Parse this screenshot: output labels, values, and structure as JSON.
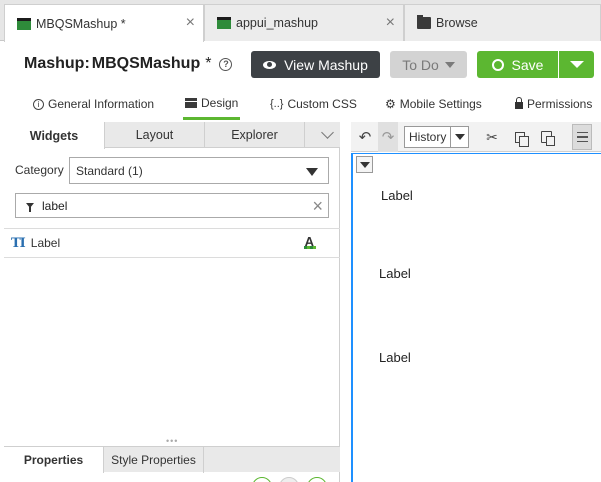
{
  "tabs": [
    {
      "label": "MBQSMashup *",
      "icon": "mashup-icon"
    },
    {
      "label": "appui_mashup",
      "icon": "mashup-icon"
    },
    {
      "label": "Browse",
      "icon": "folder-icon"
    }
  ],
  "close_glyph": "×",
  "header": {
    "title_prefix": "Mashup:",
    "title_name": "MBQSMashup",
    "modified_marker": "*",
    "view_button": "View Mashup",
    "todo_button": "To Do",
    "save_button": "Save"
  },
  "subnav": [
    "General Information",
    "Design",
    "Custom CSS",
    "Mobile Settings",
    "Permissions"
  ],
  "panel": {
    "tabs": [
      "Widgets",
      "Layout",
      "Explorer"
    ],
    "category_label": "Category",
    "category_value": "Standard (1)",
    "filter_value": "label",
    "widgets": [
      {
        "label": "Label"
      }
    ],
    "bottom_tabs": [
      "Properties",
      "Style Properties"
    ]
  },
  "toolbar": {
    "history_label": "History"
  },
  "canvas": {
    "labels": [
      "Label",
      "Label",
      "Label"
    ]
  },
  "colors": {
    "accent_green": "#5cb731",
    "dark_button": "#3d4145",
    "selection_blue": "#1e90ff"
  }
}
